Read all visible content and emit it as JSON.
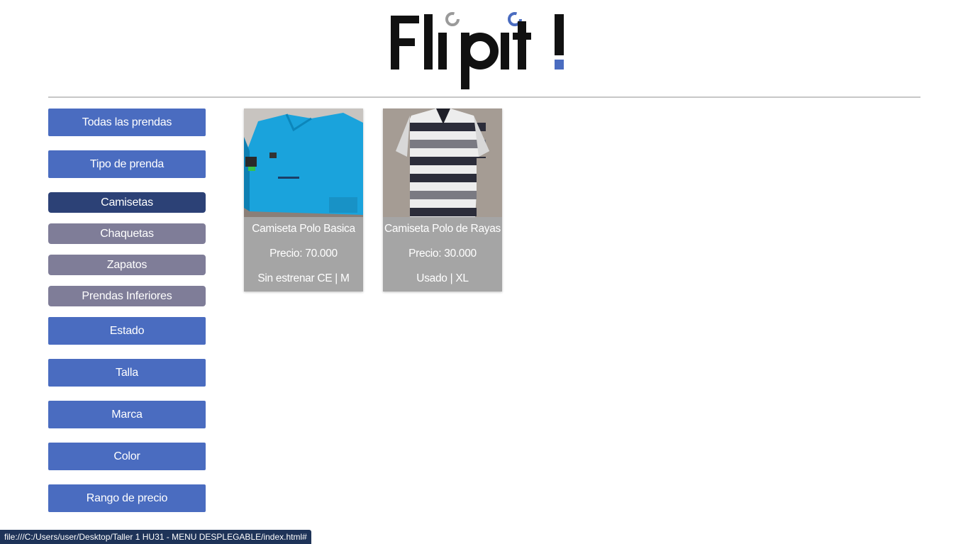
{
  "brand": {
    "logo_text": "Flipit!",
    "accent": "#4a6cc0"
  },
  "sidebar": {
    "items": [
      {
        "label": "Todas las prendas"
      },
      {
        "label": "Tipo de prenda"
      },
      {
        "label": "Camisetas"
      },
      {
        "label": "Chaquetas"
      },
      {
        "label": "Zapatos"
      },
      {
        "label": "Prendas Inferiores"
      },
      {
        "label": "Estado"
      },
      {
        "label": "Talla"
      },
      {
        "label": "Marca"
      },
      {
        "label": "Color"
      },
      {
        "label": "Rango de precio"
      }
    ]
  },
  "products": [
    {
      "name": "Camiseta Polo Basica",
      "price": "Precio: 70.000",
      "details": "Sin estrenar CE | M",
      "image": "blue-polo-shirt"
    },
    {
      "name": "Camiseta Polo de Rayas",
      "price": "Precio: 30.000",
      "details": "Usado | XL",
      "image": "striped-polo-shirt"
    }
  ],
  "statusbar": {
    "url": "file:///C:/Users/user/Desktop/Taller 1 HU31 - MENU DESPLEGABLE/index.html#"
  }
}
